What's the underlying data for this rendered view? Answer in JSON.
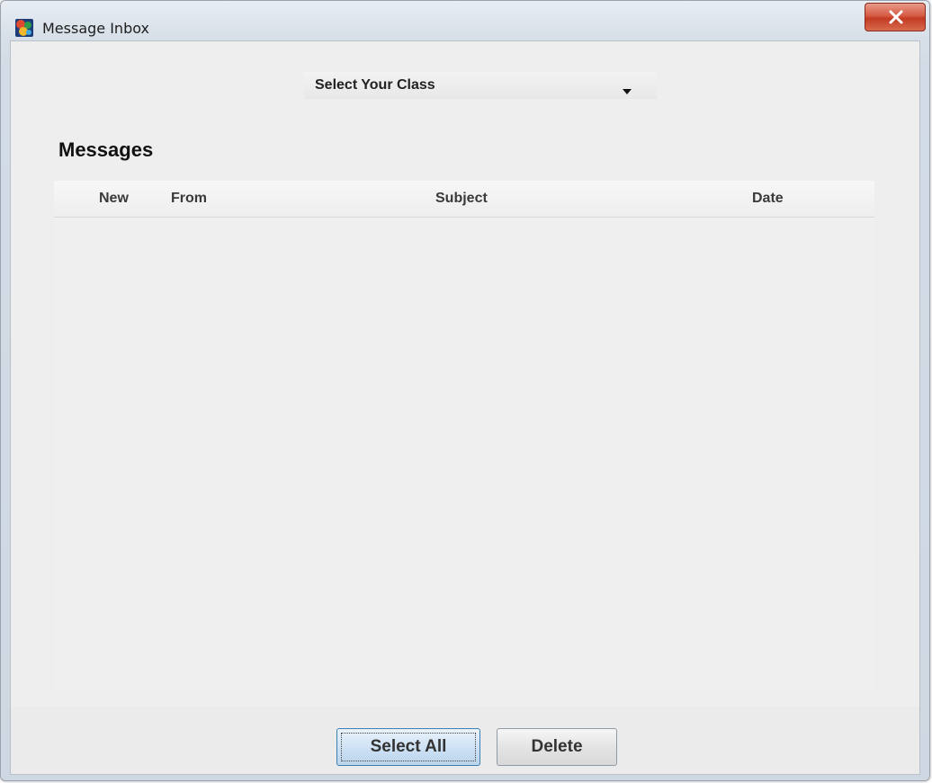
{
  "window": {
    "title": "Message Inbox",
    "icons": {
      "app": "app-logo-icon",
      "close": "close-icon"
    }
  },
  "class_selector": {
    "selected_label": "Select Your Class",
    "icon": "dropdown-arrow-icon"
  },
  "messages": {
    "heading": "Messages",
    "columns": {
      "new": "New",
      "from": "From",
      "subject": "Subject",
      "date": "Date"
    },
    "rows": []
  },
  "actions": {
    "select_all_label": "Select All",
    "delete_label": "Delete"
  },
  "colors": {
    "close_button": "#c9432a",
    "primary_button": "#cfe2f4"
  }
}
